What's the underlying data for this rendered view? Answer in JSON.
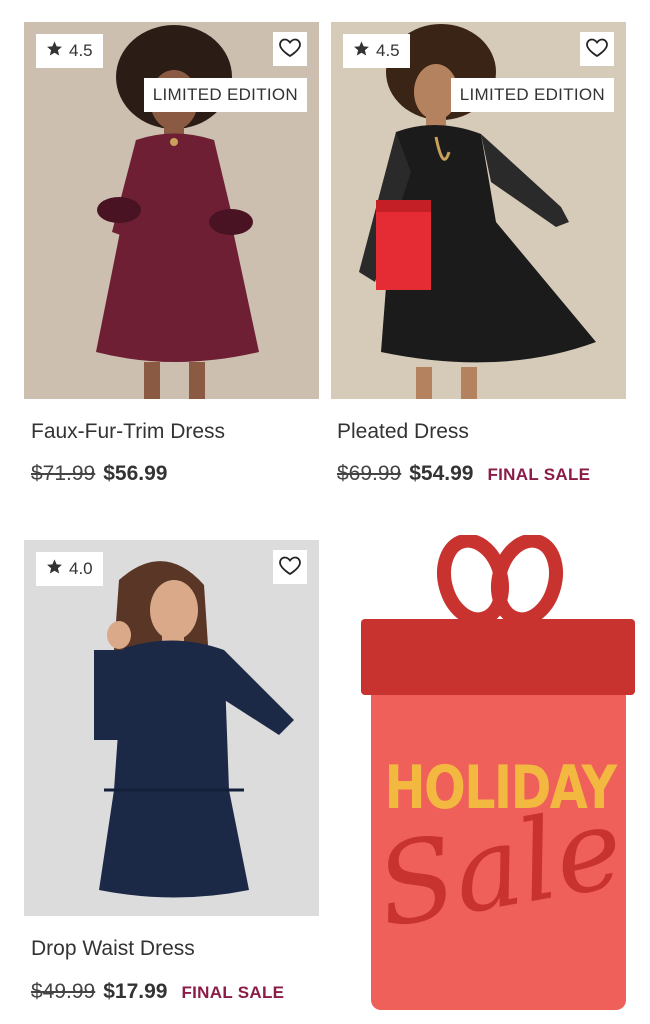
{
  "products": [
    {
      "rating": "4.5",
      "badge": "LIMITED EDITION",
      "name": "Faux-Fur-Trim Dress",
      "old_price": "$71.99",
      "new_price": "$56.99",
      "final_sale": ""
    },
    {
      "rating": "4.5",
      "badge": "LIMITED EDITION",
      "name": "Pleated Dress",
      "old_price": "$69.99",
      "new_price": "$54.99",
      "final_sale": "FINAL SALE"
    },
    {
      "rating": "4.0",
      "badge": "",
      "name": "Drop Waist Dress",
      "old_price": "$49.99",
      "new_price": "$17.99",
      "final_sale": "FINAL SALE"
    }
  ],
  "promo": {
    "line1": "HOLIDAY",
    "line2": "Sale"
  },
  "colors": {
    "final_sale": "#8a1c47",
    "gift_box": "#f0605a",
    "gift_lid": "#c83330",
    "holiday_text": "#f2b83f"
  },
  "icons": {
    "rating": "star-icon",
    "wishlist": "heart-outline-icon"
  }
}
